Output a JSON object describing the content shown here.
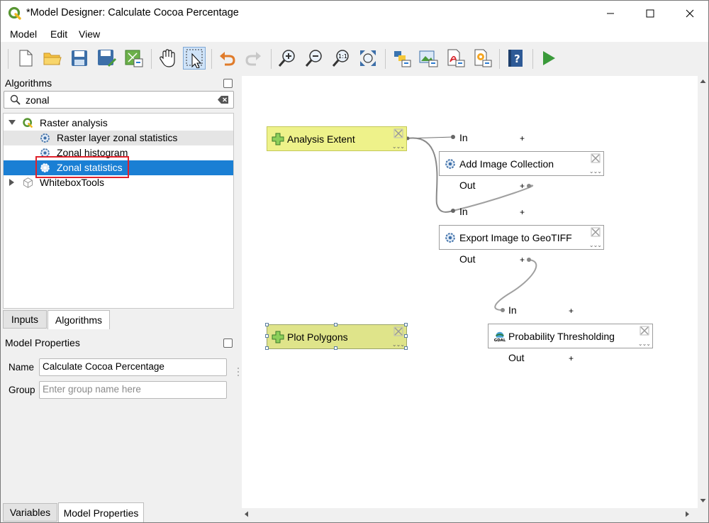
{
  "window": {
    "title": "*Model Designer: Calculate Cocoa Percentage"
  },
  "menu": {
    "model": "Model",
    "edit": "Edit",
    "view": "View"
  },
  "algorithms_panel": {
    "title": "Algorithms",
    "search_value": "zonal",
    "tree": [
      {
        "label": "Raster analysis",
        "expanded": true
      },
      {
        "label": "Raster layer zonal statistics"
      },
      {
        "label": "Zonal histogram"
      },
      {
        "label": "Zonal statistics",
        "selected": true
      },
      {
        "label": "WhiteboxTools",
        "expanded": false
      }
    ]
  },
  "tabs_top": {
    "inputs": "Inputs",
    "algorithms": "Algorithms"
  },
  "model_properties": {
    "title": "Model Properties",
    "name_label": "Name",
    "name_value": "Calculate Cocoa Percentage",
    "group_label": "Group",
    "group_placeholder": "Enter group name here"
  },
  "tabs_bottom": {
    "variables": "Variables",
    "model_properties": "Model Properties"
  },
  "canvas": {
    "inputs": [
      {
        "label": "Analysis Extent"
      },
      {
        "label": "Plot Polygons"
      }
    ],
    "algorithms": [
      {
        "label": "Add Image Collection",
        "in": "In",
        "out": "Out"
      },
      {
        "label": "Export Image to GeoTIFF",
        "in": "In",
        "out": "Out"
      },
      {
        "label": "Probability Thresholding",
        "in": "In",
        "out": "Out"
      }
    ],
    "plus": "+"
  },
  "colors": {
    "selection": "#1a7fd4",
    "input_node": "#eef28a",
    "run": "#3a9a3a",
    "highlight": "#e0212b"
  }
}
